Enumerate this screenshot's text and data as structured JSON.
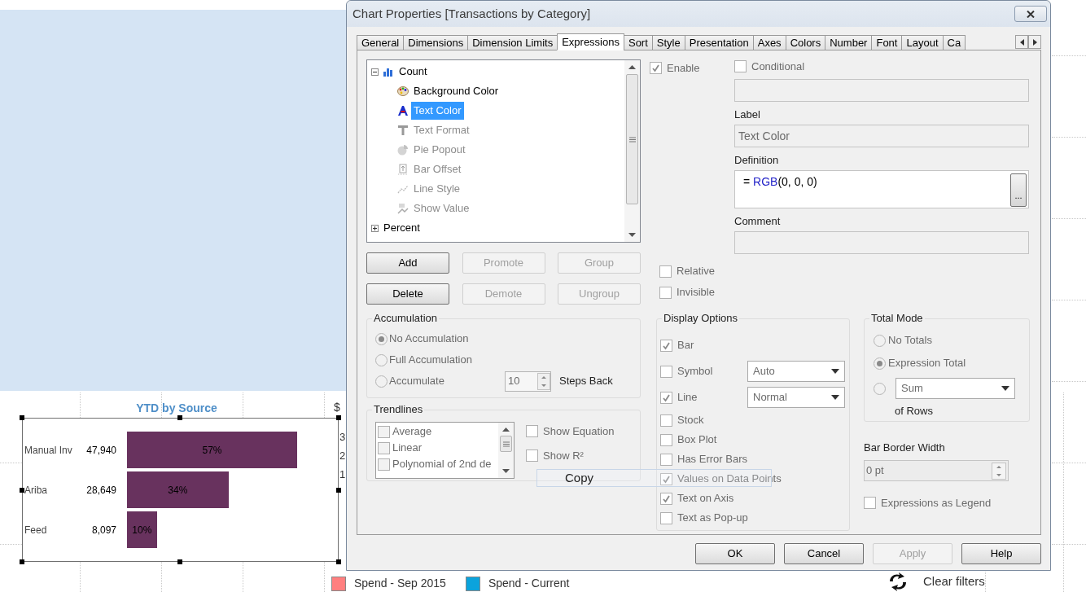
{
  "background": {
    "chart_data": {
      "type": "bar",
      "orientation": "horizontal",
      "title": "YTD by Source",
      "categories": [
        "Manual Inv",
        "Ariba",
        "Feed"
      ],
      "values": [
        57,
        34,
        10
      ],
      "value_labels": [
        "57%",
        "34%",
        "10%"
      ]
    },
    "amounts": [
      "47,940",
      "28,649",
      "8,097"
    ],
    "partial_chart": {
      "label": "$",
      "ticks": [
        "3",
        "2",
        "1"
      ]
    },
    "legend": [
      {
        "label": "Spend - Sep 2015",
        "color": "#ff7f7f"
      },
      {
        "label": "Spend - Current",
        "color": "#0ba3dc"
      }
    ],
    "clear_filters": "Clear filters"
  },
  "dialog": {
    "title": "Chart Properties [Transactions by Category]",
    "tabs": [
      {
        "label": "General",
        "selected": false
      },
      {
        "label": "Dimensions",
        "selected": false
      },
      {
        "label": "Dimension Limits",
        "selected": false
      },
      {
        "label": "Expressions",
        "selected": true
      },
      {
        "label": "Sort",
        "selected": false
      },
      {
        "label": "Style",
        "selected": false
      },
      {
        "label": "Presentation",
        "selected": false
      },
      {
        "label": "Axes",
        "selected": false
      },
      {
        "label": "Colors",
        "selected": false
      },
      {
        "label": "Number",
        "selected": false
      },
      {
        "label": "Font",
        "selected": false
      },
      {
        "label": "Layout",
        "selected": false
      },
      {
        "label": "Ca",
        "selected": false
      }
    ],
    "tree": [
      {
        "label": "Count",
        "expanded": true,
        "children": [
          {
            "label": "Background Color",
            "kind": "palette",
            "disabled": false,
            "selected": false
          },
          {
            "label": "Text Color",
            "kind": "text-color",
            "disabled": false,
            "selected": true
          },
          {
            "label": "Text Format",
            "kind": "text-format",
            "disabled": true,
            "selected": false
          },
          {
            "label": "Pie Popout",
            "kind": "pie",
            "disabled": true,
            "selected": false
          },
          {
            "label": "Bar Offset",
            "kind": "bar-offset",
            "disabled": true,
            "selected": false
          },
          {
            "label": "Line Style",
            "kind": "line-style",
            "disabled": true,
            "selected": false
          },
          {
            "label": "Show Value",
            "kind": "show-value",
            "disabled": true,
            "selected": false
          }
        ]
      },
      {
        "label": "Percent",
        "expanded": false
      }
    ],
    "expression_buttons": [
      [
        {
          "label": "Add",
          "disabled": false
        },
        {
          "label": "Promote",
          "disabled": true
        },
        {
          "label": "Group",
          "disabled": true
        }
      ],
      [
        {
          "label": "Delete",
          "disabled": false
        },
        {
          "label": "Demote",
          "disabled": true
        },
        {
          "label": "Ungroup",
          "disabled": true
        }
      ]
    ],
    "enable": {
      "label": "Enable",
      "checked": true
    },
    "conditional": {
      "label": "Conditional",
      "checked": false
    },
    "label_field": {
      "label": "Label",
      "value": "Text Color"
    },
    "definition": {
      "label": "Definition",
      "prefix": "= ",
      "function": "RGB",
      "args": "(0, 0, 0)",
      "button": "..."
    },
    "comment": {
      "label": "Comment"
    },
    "relative": {
      "label": "Relative",
      "checked": false
    },
    "invisible": {
      "label": "Invisible",
      "checked": false
    },
    "accumulation": {
      "title": "Accumulation",
      "options": [
        {
          "label": "No Accumulation",
          "selected": true
        },
        {
          "label": "Full Accumulation",
          "selected": false
        },
        {
          "label": "Accumulate",
          "selected": false
        }
      ],
      "steps": "10",
      "steps_label": "Steps Back"
    },
    "trendlines": {
      "title": "Trendlines",
      "items": [
        {
          "label": "Average",
          "checked": false
        },
        {
          "label": "Linear",
          "checked": false
        },
        {
          "label": "Polynomial of 2nd de",
          "checked": false
        }
      ],
      "show_equation": {
        "label": "Show Equation",
        "checked": false
      },
      "show_r2": {
        "label": "Show R²",
        "checked": false
      }
    },
    "display_options": {
      "title": "Display Options",
      "items": [
        {
          "label": "Bar",
          "checked": true
        },
        {
          "label": "Symbol",
          "checked": false,
          "dropdown": "Auto"
        },
        {
          "label": "Line",
          "checked": true,
          "dropdown": "Normal"
        },
        {
          "label": "Stock",
          "checked": false
        },
        {
          "label": "Box Plot",
          "checked": false
        },
        {
          "label": "Has Error Bars",
          "checked": false
        },
        {
          "label": "Values on Data Points",
          "checked": true
        },
        {
          "label": "Text on Axis",
          "checked": true
        },
        {
          "label": "Text as Pop-up",
          "checked": false
        }
      ]
    },
    "total_mode": {
      "title": "Total Mode",
      "options": [
        {
          "label": "No Totals",
          "selected": false
        },
        {
          "label": "Expression Total",
          "selected": true
        },
        {
          "kind": "dropdown",
          "value": "Sum",
          "selected": false
        }
      ],
      "suffix": "of Rows"
    },
    "bar_border_width": {
      "label": "Bar Border Width",
      "value": "0 pt"
    },
    "expressions_as_legend": {
      "label": "Expressions as Legend",
      "checked": false
    },
    "footer_buttons": [
      {
        "label": "OK",
        "disabled": false
      },
      {
        "label": "Cancel",
        "disabled": false
      },
      {
        "label": "Apply",
        "disabled": true
      },
      {
        "label": "Help",
        "disabled": false
      }
    ]
  },
  "tooltip": {
    "label": "Copy"
  }
}
